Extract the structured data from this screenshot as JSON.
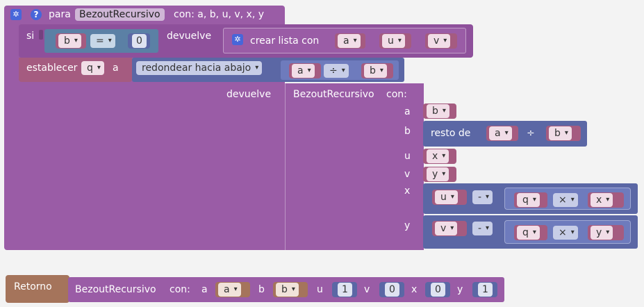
{
  "proc": {
    "keyword": "para",
    "name": "BezoutRecursivo",
    "params": "con: a, b, u, v, x, y",
    "help": "?"
  },
  "si": {
    "label": "si",
    "var_b": "b",
    "op": "=",
    "zero": "0",
    "returns": "devuelve",
    "list_label": "crear lista con",
    "items": [
      "a",
      "u",
      "v"
    ]
  },
  "set": {
    "label": "establecer",
    "var": "q",
    "to": "a",
    "round": "redondear hacia abajo",
    "lhs": "a",
    "op": "÷",
    "rhs": "b"
  },
  "ret": {
    "label": "devuelve",
    "call": "BezoutRecursivo",
    "con": "con:",
    "a_label": "a",
    "a_val": "b",
    "b_label": "b",
    "mod_label": "resto de",
    "mod_lhs": "a",
    "mod_op": "÷",
    "mod_rhs": "b",
    "u_label": "u",
    "u_val": "x",
    "v_label": "v",
    "v_val": "y",
    "x_label": "x",
    "x_lhs": "u",
    "x_minus": "-",
    "x_q": "q",
    "x_times": "×",
    "x_var": "x",
    "y_label": "y",
    "y_lhs": "v",
    "y_minus": "-",
    "y_q": "q",
    "y_times": "×",
    "y_var": "y"
  },
  "retorno": {
    "label": "Retorno",
    "call": "BezoutRecursivo",
    "con": "con:",
    "a_label": "a",
    "a_val": "a",
    "b_label": "b",
    "b_val": "b",
    "u_label": "u",
    "u_val": "1",
    "v_label": "v",
    "v_val": "0",
    "x_label": "x",
    "x_val": "0",
    "y_label": "y",
    "y_val": "1"
  },
  "colors": {
    "procedure": "#9a5ca6",
    "logic": "#5b80a5",
    "math": "#5b67a5",
    "variable": "#a55b80",
    "return": "#a5745b"
  }
}
